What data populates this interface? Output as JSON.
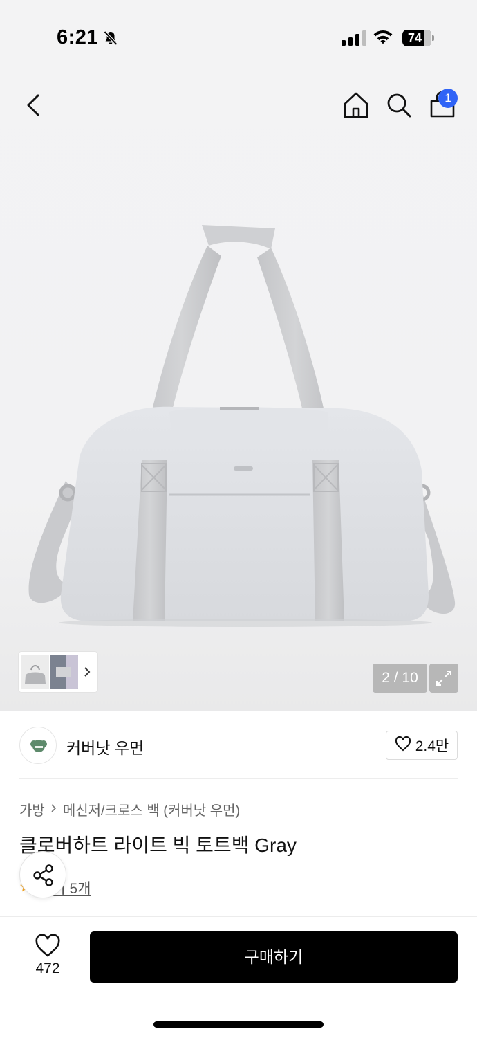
{
  "status_bar": {
    "time": "6:21",
    "battery": "74",
    "icons": [
      "bell-off-icon",
      "signal-icon",
      "wifi-icon",
      "battery-icon"
    ]
  },
  "nav": {
    "icons": [
      "back-chevron-icon",
      "home-icon",
      "search-icon",
      "shopping-bag-icon"
    ],
    "cart_count": "1"
  },
  "gallery": {
    "counter": "2 / 10",
    "expand_icon": "expand-icon"
  },
  "brand": {
    "name": "커버낫 우먼",
    "likes": "2.4만"
  },
  "breadcrumb": {
    "category": "가방",
    "subcategory": "메신저/크로스 백 (커버낫 우먼)"
  },
  "product": {
    "title": "클로버하트 라이트 빅 토트백 Gray",
    "review_label": "후기 5개"
  },
  "bottom_bar": {
    "wish_count": "472",
    "buy_label": "구매하기"
  },
  "colors": {
    "accent_badge": "#2f63f6",
    "buy_button": "#000000"
  }
}
